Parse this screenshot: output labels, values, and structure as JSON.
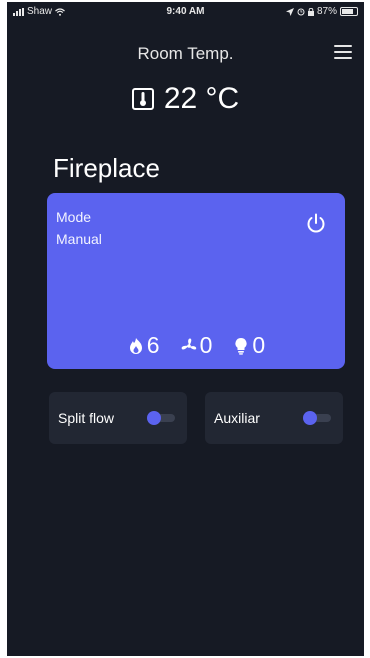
{
  "status_bar": {
    "carrier": "Shaw",
    "time": "9:40 AM",
    "battery": "87%"
  },
  "header": {
    "title": "Room Temp.",
    "menu_icon": "hamburger-menu-icon"
  },
  "temperature": {
    "value": "22 °C",
    "icon": "thermometer-icon"
  },
  "section": {
    "title": "Fireplace"
  },
  "mode_card": {
    "label": "Mode",
    "value": "Manual",
    "power_icon": "power-icon",
    "stats": [
      {
        "icon": "flame-icon",
        "value": "6"
      },
      {
        "icon": "fan-icon",
        "value": "0"
      },
      {
        "icon": "bulb-icon",
        "value": "0"
      }
    ]
  },
  "toggles": [
    {
      "label": "Split flow",
      "on": false
    },
    {
      "label": "Auxiliar",
      "on": false
    }
  ],
  "colors": {
    "background": "#161a24",
    "accent": "#5b63ef",
    "card": "#222733"
  }
}
